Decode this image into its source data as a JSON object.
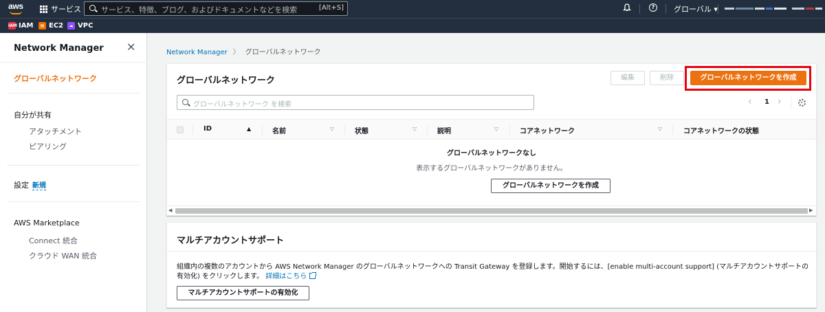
{
  "topnav": {
    "logo_text": "aws",
    "services_label": "サービス",
    "search_placeholder": "サービス、特徴、ブログ、およびドキュメントなどを検索",
    "search_shortcut": "[Alt+S]",
    "region_label": "グローバル ▾",
    "help_glyph": "?"
  },
  "favorites": [
    {
      "label": "IAM",
      "color": "#dd344c"
    },
    {
      "label": "EC2",
      "color": "#ed7100"
    },
    {
      "label": "VPC",
      "color": "#8c4fff"
    }
  ],
  "sidebar": {
    "title": "Network Manager",
    "close_glyph": "✕",
    "active_item": "グローバルネットワーク",
    "shared_section": "自分が共有",
    "shared_items": [
      "アタッチメント",
      "ピアリング"
    ],
    "settings_label": "設定",
    "settings_badge": "新規",
    "marketplace_section": "AWS Marketplace",
    "marketplace_items": [
      "Connect 統合",
      "クラウド WAN 統合"
    ]
  },
  "breadcrumb": {
    "root": "Network Manager",
    "current": "グローバルネットワーク"
  },
  "global_networks": {
    "title": "グローバルネットワーク",
    "edit_button": "編集",
    "delete_button": "削除",
    "create_button": "グローバルネットワークを作成",
    "filter_placeholder": "グローバルネットワーク を検索",
    "page_number": "1",
    "columns": [
      "ID",
      "名前",
      "状態",
      "説明",
      "コアネットワーク",
      "コアネットワークの状態"
    ],
    "empty_title": "グローバルネットワークなし",
    "empty_description": "表示するグローバルネットワークがありません。",
    "empty_create_button": "グローバルネットワークを作成"
  },
  "multi_account": {
    "title": "マルチアカウントサポート",
    "description": "組織内の複数のアカウントから AWS Network Manager のグローバルネットワークへの Transit Gateway を登録します。開始するには、[enable multi-account support] (マルチアカウントサポートの有効化) をクリックします。",
    "learn_more_link": "詳細はこちら",
    "enable_button": "マルチアカウントサポートの有効化"
  },
  "colors": {
    "nav_bg": "#232f3e",
    "accent": "#ec7211",
    "link": "#0073bb",
    "highlight": "#e8000d"
  }
}
